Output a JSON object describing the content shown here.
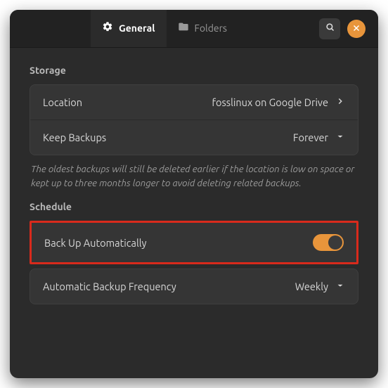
{
  "tabs": {
    "general": "General",
    "folders": "Folders"
  },
  "storage": {
    "header": "Storage",
    "location_label": "Location",
    "location_value": "fosslinux on Google Drive",
    "keep_label": "Keep Backups",
    "keep_value": "Forever",
    "help": "The oldest backups will still be deleted earlier if the location is low on space or kept up to three months longer to avoid deleting related backups."
  },
  "schedule": {
    "header": "Schedule",
    "auto_label": "Back Up Automatically",
    "auto_on": true,
    "freq_label": "Automatic Backup Frequency",
    "freq_value": "Weekly"
  }
}
